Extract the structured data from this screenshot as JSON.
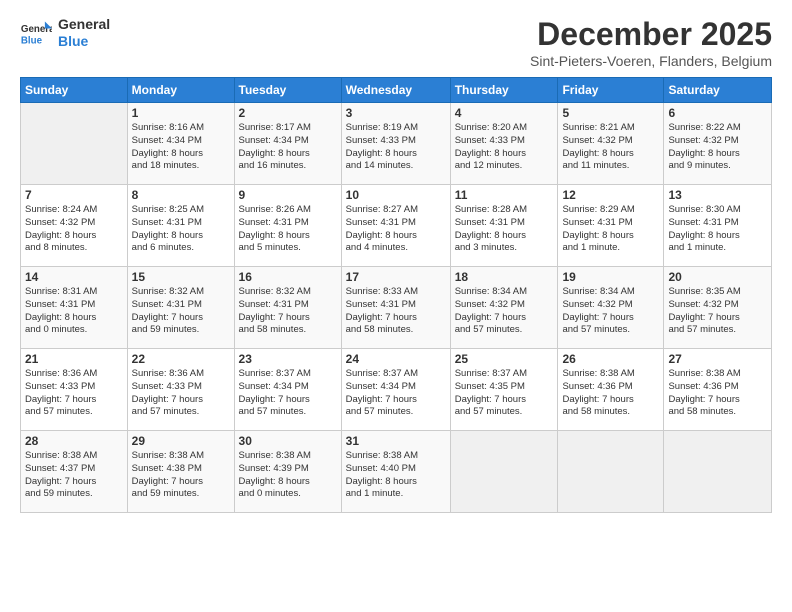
{
  "logo": {
    "line1": "General",
    "line2": "Blue"
  },
  "title": "December 2025",
  "location": "Sint-Pieters-Voeren, Flanders, Belgium",
  "days_header": [
    "Sunday",
    "Monday",
    "Tuesday",
    "Wednesday",
    "Thursday",
    "Friday",
    "Saturday"
  ],
  "weeks": [
    [
      {
        "num": "",
        "info": ""
      },
      {
        "num": "1",
        "info": "Sunrise: 8:16 AM\nSunset: 4:34 PM\nDaylight: 8 hours\nand 18 minutes."
      },
      {
        "num": "2",
        "info": "Sunrise: 8:17 AM\nSunset: 4:34 PM\nDaylight: 8 hours\nand 16 minutes."
      },
      {
        "num": "3",
        "info": "Sunrise: 8:19 AM\nSunset: 4:33 PM\nDaylight: 8 hours\nand 14 minutes."
      },
      {
        "num": "4",
        "info": "Sunrise: 8:20 AM\nSunset: 4:33 PM\nDaylight: 8 hours\nand 12 minutes."
      },
      {
        "num": "5",
        "info": "Sunrise: 8:21 AM\nSunset: 4:32 PM\nDaylight: 8 hours\nand 11 minutes."
      },
      {
        "num": "6",
        "info": "Sunrise: 8:22 AM\nSunset: 4:32 PM\nDaylight: 8 hours\nand 9 minutes."
      }
    ],
    [
      {
        "num": "7",
        "info": "Sunrise: 8:24 AM\nSunset: 4:32 PM\nDaylight: 8 hours\nand 8 minutes."
      },
      {
        "num": "8",
        "info": "Sunrise: 8:25 AM\nSunset: 4:31 PM\nDaylight: 8 hours\nand 6 minutes."
      },
      {
        "num": "9",
        "info": "Sunrise: 8:26 AM\nSunset: 4:31 PM\nDaylight: 8 hours\nand 5 minutes."
      },
      {
        "num": "10",
        "info": "Sunrise: 8:27 AM\nSunset: 4:31 PM\nDaylight: 8 hours\nand 4 minutes."
      },
      {
        "num": "11",
        "info": "Sunrise: 8:28 AM\nSunset: 4:31 PM\nDaylight: 8 hours\nand 3 minutes."
      },
      {
        "num": "12",
        "info": "Sunrise: 8:29 AM\nSunset: 4:31 PM\nDaylight: 8 hours\nand 1 minute."
      },
      {
        "num": "13",
        "info": "Sunrise: 8:30 AM\nSunset: 4:31 PM\nDaylight: 8 hours\nand 1 minute."
      }
    ],
    [
      {
        "num": "14",
        "info": "Sunrise: 8:31 AM\nSunset: 4:31 PM\nDaylight: 8 hours\nand 0 minutes."
      },
      {
        "num": "15",
        "info": "Sunrise: 8:32 AM\nSunset: 4:31 PM\nDaylight: 7 hours\nand 59 minutes."
      },
      {
        "num": "16",
        "info": "Sunrise: 8:32 AM\nSunset: 4:31 PM\nDaylight: 7 hours\nand 58 minutes."
      },
      {
        "num": "17",
        "info": "Sunrise: 8:33 AM\nSunset: 4:31 PM\nDaylight: 7 hours\nand 58 minutes."
      },
      {
        "num": "18",
        "info": "Sunrise: 8:34 AM\nSunset: 4:32 PM\nDaylight: 7 hours\nand 57 minutes."
      },
      {
        "num": "19",
        "info": "Sunrise: 8:34 AM\nSunset: 4:32 PM\nDaylight: 7 hours\nand 57 minutes."
      },
      {
        "num": "20",
        "info": "Sunrise: 8:35 AM\nSunset: 4:32 PM\nDaylight: 7 hours\nand 57 minutes."
      }
    ],
    [
      {
        "num": "21",
        "info": "Sunrise: 8:36 AM\nSunset: 4:33 PM\nDaylight: 7 hours\nand 57 minutes."
      },
      {
        "num": "22",
        "info": "Sunrise: 8:36 AM\nSunset: 4:33 PM\nDaylight: 7 hours\nand 57 minutes."
      },
      {
        "num": "23",
        "info": "Sunrise: 8:37 AM\nSunset: 4:34 PM\nDaylight: 7 hours\nand 57 minutes."
      },
      {
        "num": "24",
        "info": "Sunrise: 8:37 AM\nSunset: 4:34 PM\nDaylight: 7 hours\nand 57 minutes."
      },
      {
        "num": "25",
        "info": "Sunrise: 8:37 AM\nSunset: 4:35 PM\nDaylight: 7 hours\nand 57 minutes."
      },
      {
        "num": "26",
        "info": "Sunrise: 8:38 AM\nSunset: 4:36 PM\nDaylight: 7 hours\nand 58 minutes."
      },
      {
        "num": "27",
        "info": "Sunrise: 8:38 AM\nSunset: 4:36 PM\nDaylight: 7 hours\nand 58 minutes."
      }
    ],
    [
      {
        "num": "28",
        "info": "Sunrise: 8:38 AM\nSunset: 4:37 PM\nDaylight: 7 hours\nand 59 minutes."
      },
      {
        "num": "29",
        "info": "Sunrise: 8:38 AM\nSunset: 4:38 PM\nDaylight: 7 hours\nand 59 minutes."
      },
      {
        "num": "30",
        "info": "Sunrise: 8:38 AM\nSunset: 4:39 PM\nDaylight: 8 hours\nand 0 minutes."
      },
      {
        "num": "31",
        "info": "Sunrise: 8:38 AM\nSunset: 4:40 PM\nDaylight: 8 hours\nand 1 minute."
      },
      {
        "num": "",
        "info": ""
      },
      {
        "num": "",
        "info": ""
      },
      {
        "num": "",
        "info": ""
      }
    ]
  ]
}
